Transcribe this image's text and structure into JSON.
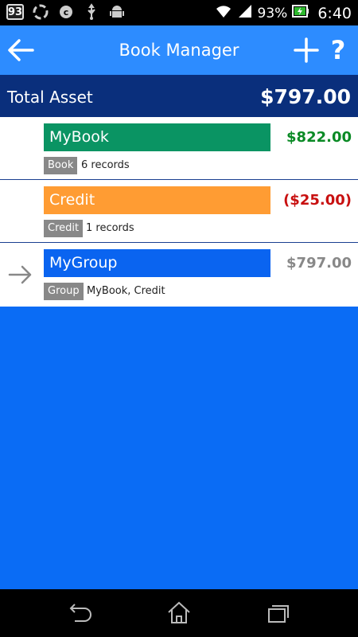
{
  "status_bar": {
    "notification_count": "93",
    "battery_percent": "93%",
    "time": "6:40",
    "icons": [
      "badge-93",
      "sync-icon",
      "c-icon",
      "usb-icon",
      "android-icon",
      "wifi-icon",
      "signal-icon",
      "battery-charging-icon"
    ]
  },
  "action_bar": {
    "title": "Book Manager",
    "back_icon": "back-arrow-icon",
    "add_icon": "plus-icon",
    "help_label": "?"
  },
  "total": {
    "label": "Total Asset",
    "value": "$797.00"
  },
  "items": [
    {
      "name": "MyBook",
      "amount": "$822.00",
      "type": "Book",
      "detail": "6 records",
      "bar_color": "#0a9463",
      "amount_color": "#0a8a25"
    },
    {
      "name": "Credit",
      "amount": "($25.00)",
      "type": "Credit",
      "detail": "1 records",
      "bar_color": "#ff9c33",
      "amount_color": "#c81010"
    },
    {
      "name": "MyGroup",
      "amount": "$797.00",
      "type": "Group",
      "detail": "MyBook, Credit",
      "bar_color": "#0a64f0",
      "amount_color": "#888888"
    }
  ],
  "colors": {
    "action_bar": "#2d8cff",
    "total_bar": "#0a2f7c",
    "background": "#0a6cf5"
  }
}
